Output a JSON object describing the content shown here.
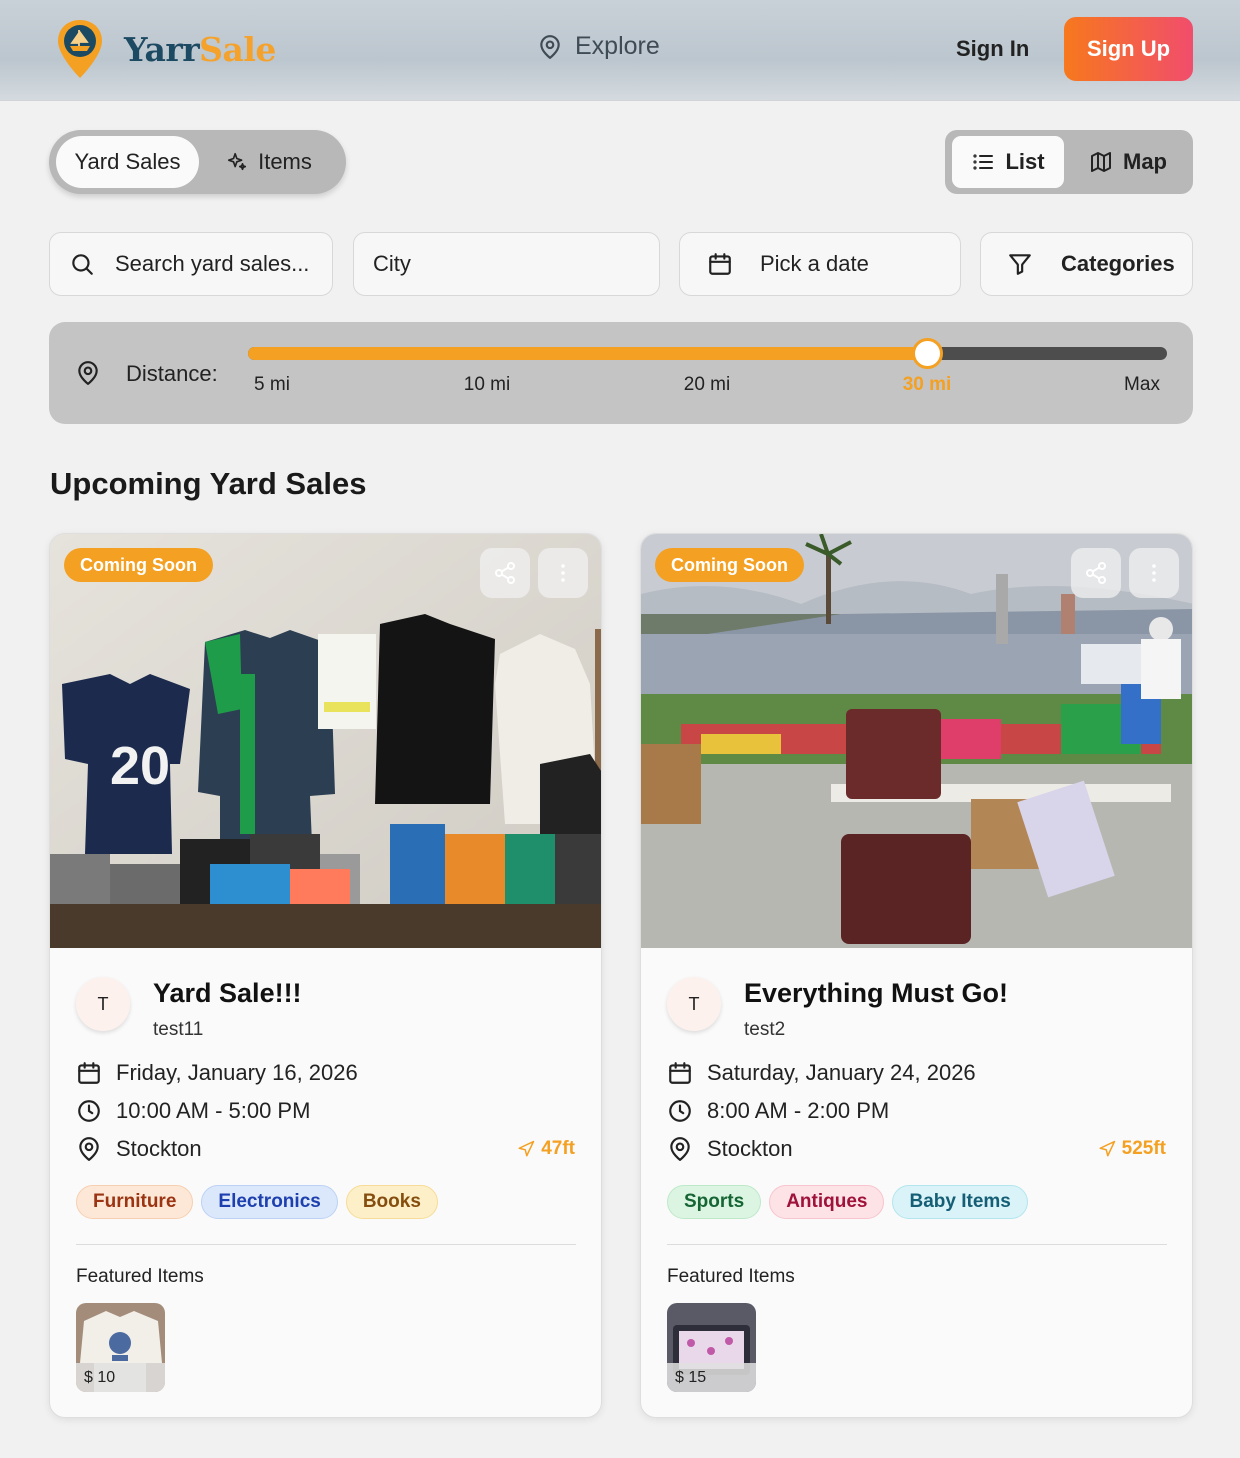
{
  "header": {
    "brand_part1": "Yarr",
    "brand_part2": "Sale",
    "explore_label": "Explore",
    "sign_in_label": "Sign In",
    "sign_up_label": "Sign Up"
  },
  "mode_toggle": {
    "active": "Yard Sales",
    "other": "Items"
  },
  "view_toggle": {
    "active": "List",
    "other": "Map"
  },
  "filters": {
    "search_placeholder": "Search yard sales...",
    "city_placeholder": "City",
    "date_placeholder": "Pick a date",
    "categories_label": "Categories"
  },
  "distance": {
    "label": "Distance:",
    "ticks": [
      "5 mi",
      "10 mi",
      "20 mi",
      "30 mi",
      "Max"
    ],
    "selected": "30 mi",
    "selected_index": 3
  },
  "section_title": "Upcoming Yard Sales",
  "colors": {
    "accent_orange": "#f4a022",
    "signup_start": "#f7781d",
    "signup_end": "#f14d6c",
    "brand_navy": "#1d4a63"
  },
  "sales": [
    {
      "badge": "Coming Soon",
      "avatar_initial": "T",
      "title": "Yard Sale!!!",
      "host": "test11",
      "date": "Friday, January 16, 2026",
      "time": "10:00 AM - 5:00 PM",
      "city": "Stockton",
      "distance": "47ft",
      "categories": [
        {
          "label": "Furniture",
          "bg": "#fde8d8",
          "fg": "#9a3412",
          "border": "#f7cfb0"
        },
        {
          "label": "Electronics",
          "bg": "#dbe7fb",
          "fg": "#1e40af",
          "border": "#bcd2f5"
        },
        {
          "label": "Books",
          "bg": "#fdefc7",
          "fg": "#854d0e",
          "border": "#f6dc98"
        }
      ],
      "featured_label": "Featured Items",
      "featured_items": [
        {
          "price": "$ 10",
          "icon": "shirt-icon"
        }
      ]
    },
    {
      "badge": "Coming Soon",
      "avatar_initial": "T",
      "title": "Everything Must Go!",
      "host": "test2",
      "date": "Saturday, January 24, 2026",
      "time": "8:00 AM - 2:00 PM",
      "city": "Stockton",
      "distance": "525ft",
      "categories": [
        {
          "label": "Sports",
          "bg": "#dcf5e2",
          "fg": "#166534",
          "border": "#bde9c9"
        },
        {
          "label": "Antiques",
          "bg": "#fde2e6",
          "fg": "#9f1239",
          "border": "#f8c5ce"
        },
        {
          "label": "Baby Items",
          "bg": "#d9f3f8",
          "fg": "#155e75",
          "border": "#b3e5ee"
        }
      ],
      "featured_label": "Featured Items",
      "featured_items": [
        {
          "price": "$ 15",
          "icon": "crib-icon"
        }
      ]
    }
  ]
}
